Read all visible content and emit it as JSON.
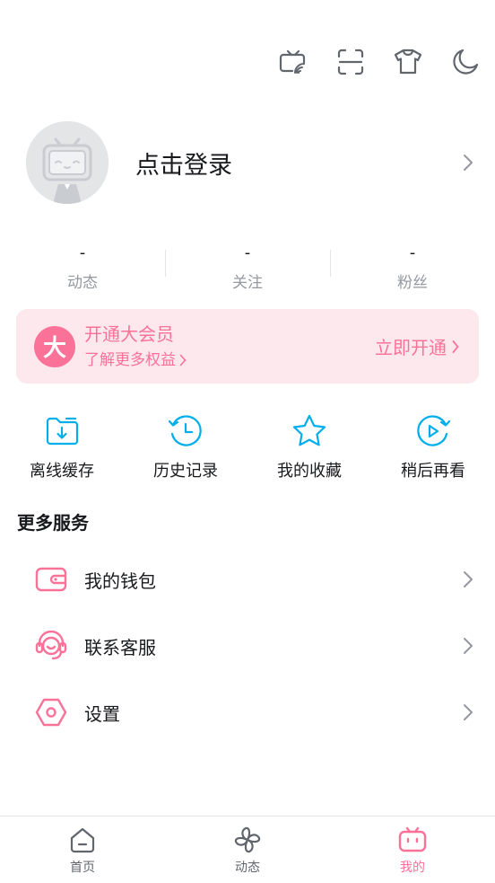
{
  "toolbar": {
    "icons": [
      "tv-cast-icon",
      "scan-icon",
      "tshirt-icon",
      "moon-icon"
    ]
  },
  "profile": {
    "login_label": "点击登录"
  },
  "stats": [
    {
      "value": "-",
      "label": "动态"
    },
    {
      "value": "-",
      "label": "关注"
    },
    {
      "value": "-",
      "label": "粉丝"
    }
  ],
  "vip": {
    "badge": "大",
    "title": "开通大会员",
    "subtitle": "了解更多权益",
    "cta": "立即开通",
    "accent": "#fb7299"
  },
  "shortcuts": [
    {
      "label": "离线缓存",
      "icon": "download-folder-icon"
    },
    {
      "label": "历史记录",
      "icon": "history-clock-icon"
    },
    {
      "label": "我的收藏",
      "icon": "star-icon"
    },
    {
      "label": "稍后再看",
      "icon": "watch-later-icon"
    }
  ],
  "more_services": {
    "title": "更多服务",
    "items": [
      {
        "label": "我的钱包",
        "icon": "wallet-icon"
      },
      {
        "label": "联系客服",
        "icon": "headset-icon"
      },
      {
        "label": "设置",
        "icon": "settings-hexagon-icon"
      }
    ]
  },
  "bottom_nav": {
    "tabs": [
      {
        "label": "首页",
        "icon": "home-icon",
        "active": false
      },
      {
        "label": "动态",
        "icon": "pinwheel-icon",
        "active": false
      },
      {
        "label": "我的",
        "icon": "tv-mine-icon",
        "active": true
      }
    ]
  },
  "colors": {
    "accent": "#fb7299",
    "blue": "#00aeec",
    "text": "#18191c",
    "muted": "#9499a0"
  }
}
